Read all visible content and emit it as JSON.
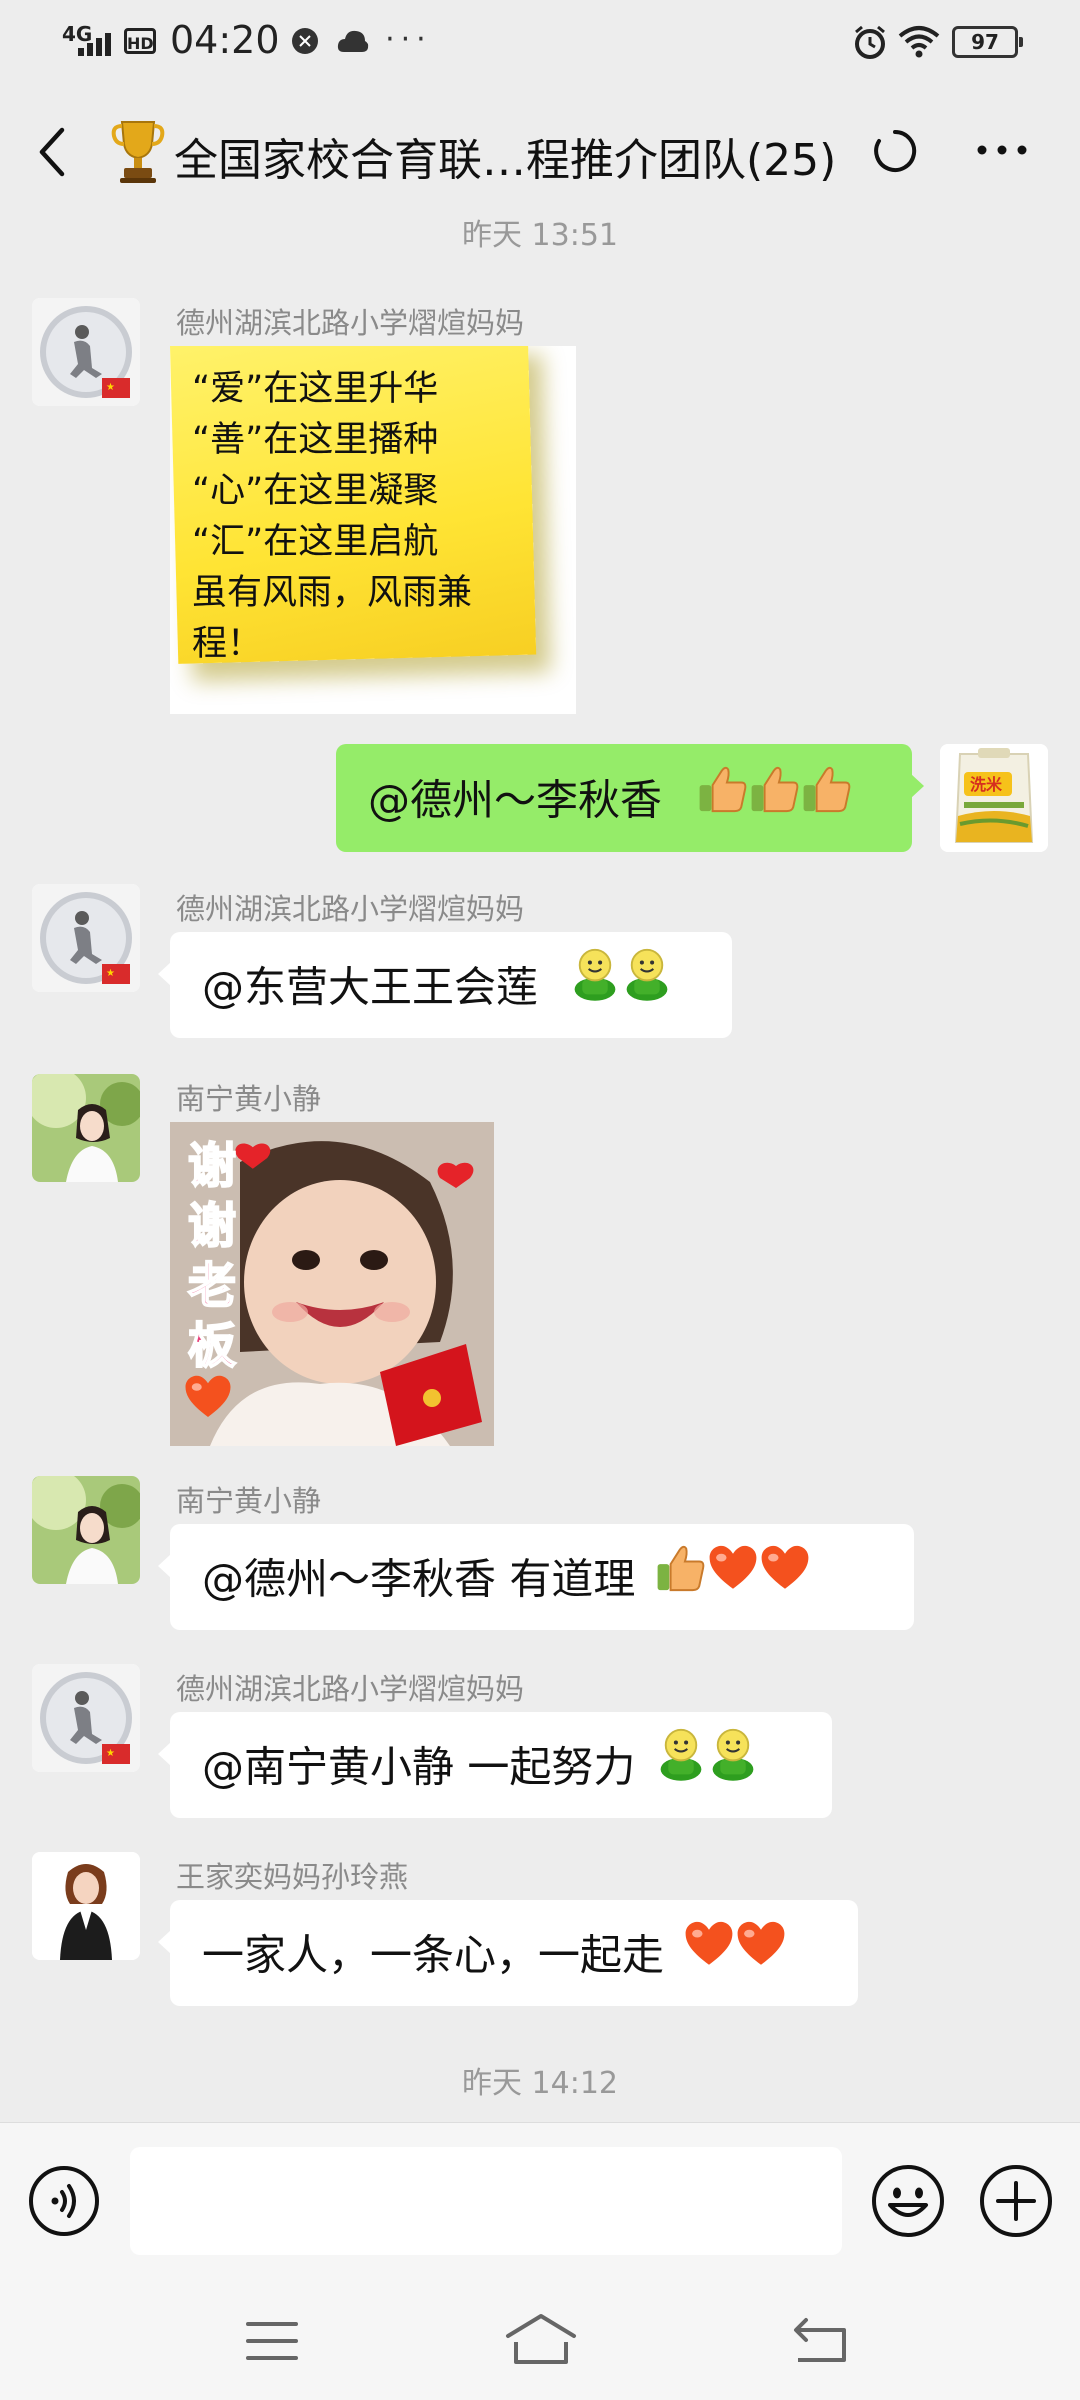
{
  "status_bar": {
    "network": "4G",
    "hd": "HD",
    "time": "04:20",
    "more_dots": "···",
    "battery": "97"
  },
  "header": {
    "back_icon": "chevron-left-icon",
    "title_emoji": "trophy-icon",
    "title": "全国家校合育联…程推介团队(25)",
    "sync_icon": "loading-circle-icon",
    "more_icon": "more-dots-icon"
  },
  "chat": {
    "timestamp_1": "昨天 13:51",
    "msg1": {
      "sender": "德州湖滨北路小学熠煊妈妈",
      "sticker_lines": [
        "“爱”在这里升华",
        "“善”在这里播种",
        "“心”在这里凝聚",
        "“汇”在这里启航",
        "虽有风雨，风雨兼",
        "程！"
      ]
    },
    "msg2": {
      "text": "@德州～李秋香",
      "emoji": "thumbs-up ×3"
    },
    "msg3": {
      "sender": "德州湖滨北路小学熠煊妈妈",
      "text": "@东营大王王会莲",
      "emoji": "green-smiley ×2"
    },
    "msg4": {
      "sender": "南宁黄小静",
      "sticker_text": [
        "谢",
        "谢",
        "老",
        "板"
      ]
    },
    "msg5": {
      "sender": "南宁黄小静",
      "text": "@德州～李秋香  有道理",
      "emoji": "thumbs-up, heart ×2"
    },
    "msg6": {
      "sender": "德州湖滨北路小学熠煊妈妈",
      "text": "@南宁黄小静  一起努力",
      "emoji": "green-smiley ×2"
    },
    "msg7": {
      "sender": "王家奕妈妈孙玲燕",
      "text": "一家人，一条心，一起走",
      "emoji": "heart ×2"
    },
    "timestamp_2": "昨天 14:12"
  },
  "input_bar": {
    "voice_icon": "voice-icon",
    "emoji_icon": "smile-icon",
    "plus_icon": "plus-icon"
  },
  "nav_bar": {
    "menu_icon": "menu-icon",
    "home_icon": "home-icon",
    "back_icon": "back-arrow-icon"
  },
  "colors": {
    "background": "#ededed",
    "bubble_self": "#95ec69",
    "bubble_other": "#ffffff",
    "sticky_note": "#ffe84a"
  }
}
